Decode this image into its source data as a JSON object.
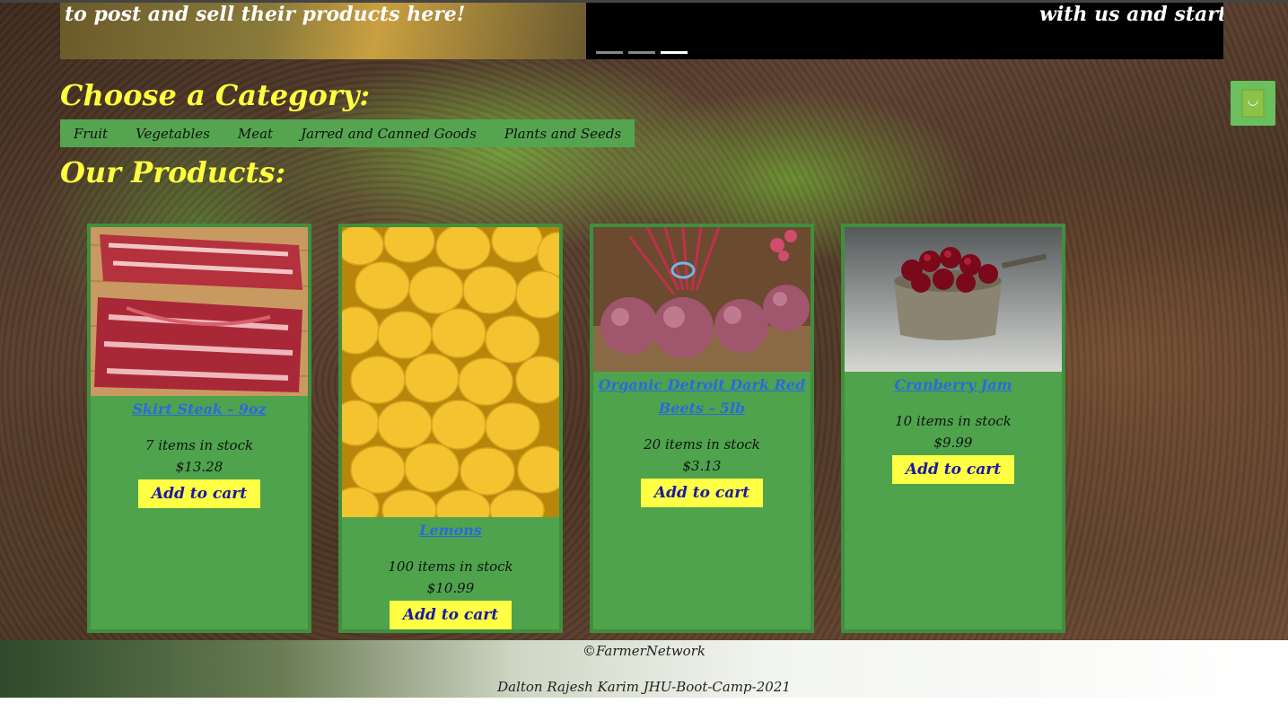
{
  "hero": {
    "text_left": "to post and sell their products here!",
    "text_right": "with us and start Po"
  },
  "headings": {
    "category": "Choose a Category:",
    "products": "Our Products:"
  },
  "categories": [
    "Fruit",
    "Vegetables",
    "Meat",
    "Jarred and Canned Goods",
    "Plants and Seeds"
  ],
  "cart": {
    "icon": "shopping-bag-icon",
    "glyph": "◡"
  },
  "products": [
    {
      "name": "Skirt Steak - 9oz",
      "stock": "7 items in stock",
      "price": "$13.28",
      "button": "Add to cart",
      "image": "skirt-steak-image"
    },
    {
      "name": "Lemons",
      "stock": "100 items in stock",
      "price": "$10.99",
      "button": "Add to cart",
      "image": "lemons-image"
    },
    {
      "name": "Organic Detroit Dark Red Beets - 5lb",
      "stock": "20 items in stock",
      "price": "$3.13",
      "button": "Add to cart",
      "image": "beets-image"
    },
    {
      "name": "Cranberry Jam",
      "stock": "10 items in stock",
      "price": "$9.99",
      "button": "Add to cart",
      "image": "cranberry-jam-image"
    }
  ],
  "footer": {
    "copyright": "©FarmerNetwork",
    "credits": "Dalton Rajesh Karim JHU-Boot-Camp-2021"
  },
  "colors": {
    "heading": "#ffff40",
    "card_bg": "#4ea34c",
    "button_bg": "#ffff44",
    "button_text": "#1a1aa0",
    "link": "#2a6ae0"
  }
}
